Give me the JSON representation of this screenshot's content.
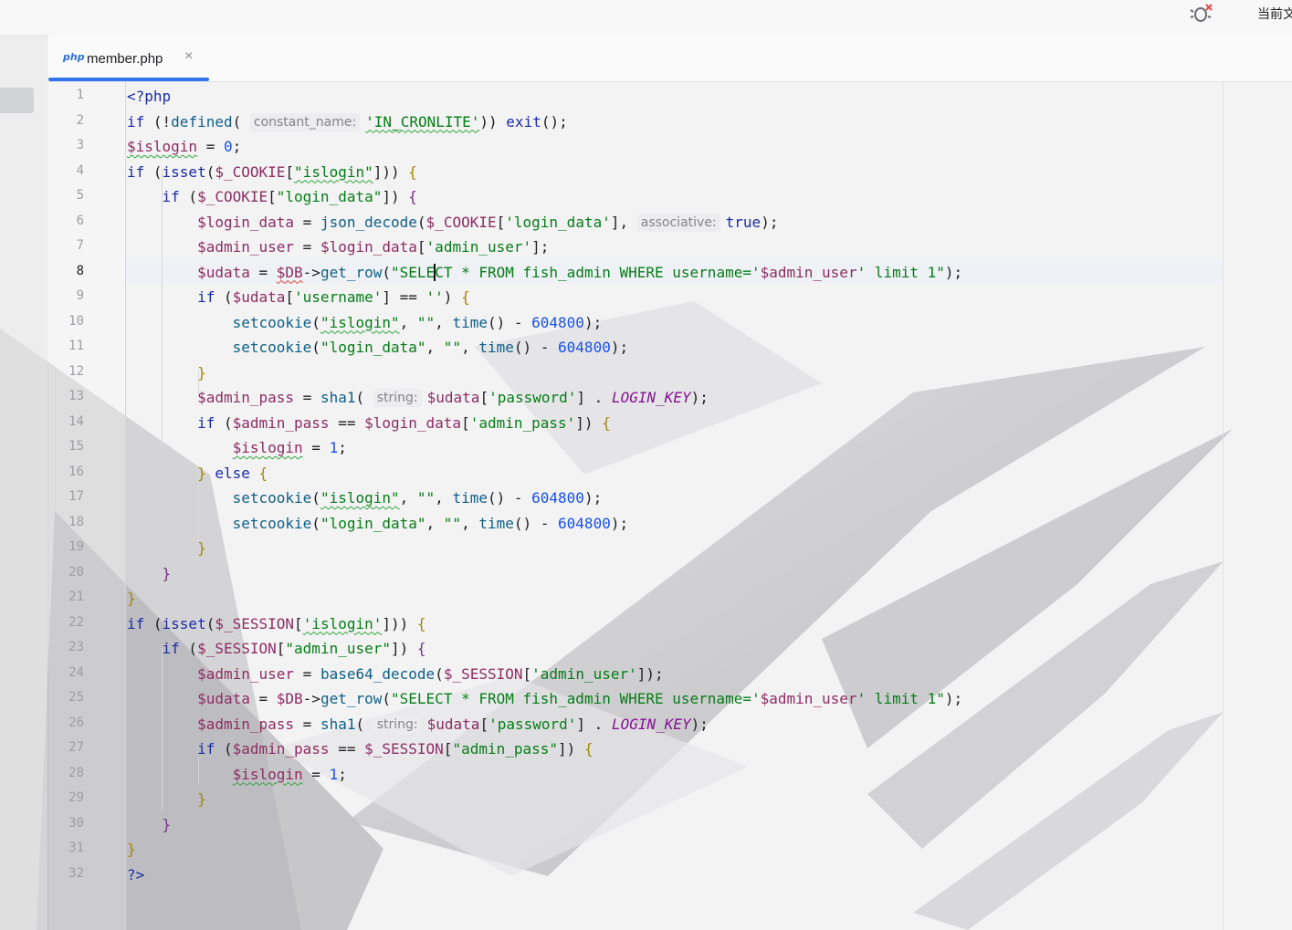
{
  "topbar": {
    "right_label": "当前文",
    "icon": "bug-icon"
  },
  "tab": {
    "icon_text": "php",
    "label": "member.php",
    "close": "×"
  },
  "editor": {
    "active_line": 8,
    "line_numbers": [
      "1",
      "2",
      "3",
      "4",
      "5",
      "6",
      "7",
      "8",
      "9",
      "10",
      "11",
      "12",
      "13",
      "14",
      "15",
      "16",
      "17",
      "18",
      "19",
      "20",
      "21",
      "22",
      "23",
      "24",
      "25",
      "26",
      "27",
      "28",
      "29",
      "30",
      "31",
      "32"
    ],
    "lines": [
      [
        {
          "t": "<?php",
          "c": "tag"
        }
      ],
      [
        {
          "t": "if",
          "c": "kw"
        },
        {
          "t": " ("
        },
        {
          "t": "!"
        },
        {
          "t": "defined",
          "c": "fn"
        },
        {
          "t": "( "
        },
        {
          "t": "constant_name:",
          "c": "hint"
        },
        {
          "t": "'IN_CRONLITE'",
          "c": "str squig"
        },
        {
          "t": ")) "
        },
        {
          "t": "exit",
          "c": "kw"
        },
        {
          "t": "();"
        }
      ],
      [
        {
          "t": "$islogin",
          "c": "var squig"
        },
        {
          "t": " = "
        },
        {
          "t": "0",
          "c": "num"
        },
        {
          "t": ";"
        }
      ],
      [
        {
          "t": "if",
          "c": "kw"
        },
        {
          "t": " ("
        },
        {
          "t": "isset",
          "c": "kw"
        },
        {
          "t": "("
        },
        {
          "t": "$_COOKIE",
          "c": "var"
        },
        {
          "t": "["
        },
        {
          "t": "\"islogin\"",
          "c": "str squig"
        },
        {
          "t": "])) "
        },
        {
          "t": "{",
          "c": "br1"
        }
      ],
      [
        {
          "t": "    "
        },
        {
          "t": "if",
          "c": "kw"
        },
        {
          "t": " ("
        },
        {
          "t": "$_COOKIE",
          "c": "var"
        },
        {
          "t": "["
        },
        {
          "t": "\"login_data\"",
          "c": "str"
        },
        {
          "t": "]) "
        },
        {
          "t": "{",
          "c": "br2"
        }
      ],
      [
        {
          "t": "        "
        },
        {
          "t": "$login_data",
          "c": "var"
        },
        {
          "t": " = "
        },
        {
          "t": "json_decode",
          "c": "fn"
        },
        {
          "t": "("
        },
        {
          "t": "$_COOKIE",
          "c": "var"
        },
        {
          "t": "["
        },
        {
          "t": "'login_data'",
          "c": "str"
        },
        {
          "t": "], "
        },
        {
          "t": "associative:",
          "c": "hint"
        },
        {
          "t": "true",
          "c": "kw"
        },
        {
          "t": ");"
        }
      ],
      [
        {
          "t": "        "
        },
        {
          "t": "$admin_user",
          "c": "var"
        },
        {
          "t": " = "
        },
        {
          "t": "$login_data",
          "c": "var"
        },
        {
          "t": "["
        },
        {
          "t": "'admin_user'",
          "c": "str"
        },
        {
          "t": "];"
        }
      ],
      [
        {
          "t": "        "
        },
        {
          "t": "$udata",
          "c": "var"
        },
        {
          "t": " = "
        },
        {
          "t": "$DB",
          "c": "var squig-red"
        },
        {
          "t": "->"
        },
        {
          "t": "get_row",
          "c": "fn"
        },
        {
          "t": "("
        },
        {
          "t": "\"SELE",
          "c": "str"
        },
        {
          "t": "",
          "c": "caret"
        },
        {
          "t": "CT * FROM fish_admin WHERE username='",
          "c": "str"
        },
        {
          "t": "$admin_user",
          "c": "var"
        },
        {
          "t": "' limit 1\"",
          "c": "str"
        },
        {
          "t": ");"
        }
      ],
      [
        {
          "t": "        "
        },
        {
          "t": "if",
          "c": "kw"
        },
        {
          "t": " ("
        },
        {
          "t": "$udata",
          "c": "var"
        },
        {
          "t": "["
        },
        {
          "t": "'username'",
          "c": "str"
        },
        {
          "t": "] == "
        },
        {
          "t": "''",
          "c": "str"
        },
        {
          "t": ") "
        },
        {
          "t": "{",
          "c": "br1"
        }
      ],
      [
        {
          "t": "            "
        },
        {
          "t": "setcookie",
          "c": "fn"
        },
        {
          "t": "("
        },
        {
          "t": "\"islogin\"",
          "c": "str squig"
        },
        {
          "t": ", "
        },
        {
          "t": "\"\"",
          "c": "str"
        },
        {
          "t": ", "
        },
        {
          "t": "time",
          "c": "fn"
        },
        {
          "t": "() - "
        },
        {
          "t": "604800",
          "c": "num"
        },
        {
          "t": ");"
        }
      ],
      [
        {
          "t": "            "
        },
        {
          "t": "setcookie",
          "c": "fn"
        },
        {
          "t": "("
        },
        {
          "t": "\"login_data\"",
          "c": "str"
        },
        {
          "t": ", "
        },
        {
          "t": "\"\"",
          "c": "str"
        },
        {
          "t": ", "
        },
        {
          "t": "time",
          "c": "fn"
        },
        {
          "t": "() - "
        },
        {
          "t": "604800",
          "c": "num"
        },
        {
          "t": ");"
        }
      ],
      [
        {
          "t": "        "
        },
        {
          "t": "}",
          "c": "br1"
        }
      ],
      [
        {
          "t": "        "
        },
        {
          "t": "$admin_pass",
          "c": "var"
        },
        {
          "t": " = "
        },
        {
          "t": "sha1",
          "c": "fn"
        },
        {
          "t": "( "
        },
        {
          "t": "string:",
          "c": "hint"
        },
        {
          "t": "$udata",
          "c": "var"
        },
        {
          "t": "["
        },
        {
          "t": "'password'",
          "c": "str"
        },
        {
          "t": "] . "
        },
        {
          "t": "LOGIN_KEY",
          "c": "const"
        },
        {
          "t": ");"
        }
      ],
      [
        {
          "t": "        "
        },
        {
          "t": "if",
          "c": "kw"
        },
        {
          "t": " ("
        },
        {
          "t": "$admin_pass",
          "c": "var"
        },
        {
          "t": " == "
        },
        {
          "t": "$login_data",
          "c": "var"
        },
        {
          "t": "["
        },
        {
          "t": "'admin_pass'",
          "c": "str"
        },
        {
          "t": "]) "
        },
        {
          "t": "{",
          "c": "br1"
        }
      ],
      [
        {
          "t": "            "
        },
        {
          "t": "$islogin",
          "c": "var squig"
        },
        {
          "t": " = "
        },
        {
          "t": "1",
          "c": "num"
        },
        {
          "t": ";"
        }
      ],
      [
        {
          "t": "        "
        },
        {
          "t": "}",
          "c": "br1"
        },
        {
          "t": " "
        },
        {
          "t": "else",
          "c": "kw"
        },
        {
          "t": " "
        },
        {
          "t": "{",
          "c": "br1"
        }
      ],
      [
        {
          "t": "            "
        },
        {
          "t": "setcookie",
          "c": "fn"
        },
        {
          "t": "("
        },
        {
          "t": "\"islogin\"",
          "c": "str squig"
        },
        {
          "t": ", "
        },
        {
          "t": "\"\"",
          "c": "str"
        },
        {
          "t": ", "
        },
        {
          "t": "time",
          "c": "fn"
        },
        {
          "t": "() - "
        },
        {
          "t": "604800",
          "c": "num"
        },
        {
          "t": ");"
        }
      ],
      [
        {
          "t": "            "
        },
        {
          "t": "setcookie",
          "c": "fn"
        },
        {
          "t": "("
        },
        {
          "t": "\"login_data\"",
          "c": "str"
        },
        {
          "t": ", "
        },
        {
          "t": "\"\"",
          "c": "str"
        },
        {
          "t": ", "
        },
        {
          "t": "time",
          "c": "fn"
        },
        {
          "t": "() - "
        },
        {
          "t": "604800",
          "c": "num"
        },
        {
          "t": ");"
        }
      ],
      [
        {
          "t": "        "
        },
        {
          "t": "}",
          "c": "br1"
        }
      ],
      [
        {
          "t": "    "
        },
        {
          "t": "}",
          "c": "br2"
        }
      ],
      [
        {
          "t": "}",
          "c": "br1"
        }
      ],
      [
        {
          "t": "if",
          "c": "kw"
        },
        {
          "t": " ("
        },
        {
          "t": "isset",
          "c": "kw"
        },
        {
          "t": "("
        },
        {
          "t": "$_SESSION",
          "c": "var"
        },
        {
          "t": "["
        },
        {
          "t": "'islogin'",
          "c": "str squig"
        },
        {
          "t": "])) "
        },
        {
          "t": "{",
          "c": "br1"
        }
      ],
      [
        {
          "t": "    "
        },
        {
          "t": "if",
          "c": "kw"
        },
        {
          "t": " ("
        },
        {
          "t": "$_SESSION",
          "c": "var"
        },
        {
          "t": "["
        },
        {
          "t": "\"admin_user\"",
          "c": "str"
        },
        {
          "t": "]) "
        },
        {
          "t": "{",
          "c": "br2"
        }
      ],
      [
        {
          "t": "        "
        },
        {
          "t": "$admin_user",
          "c": "var"
        },
        {
          "t": " = "
        },
        {
          "t": "base64_decode",
          "c": "fn"
        },
        {
          "t": "("
        },
        {
          "t": "$_SESSION",
          "c": "var"
        },
        {
          "t": "["
        },
        {
          "t": "'admin_user'",
          "c": "str"
        },
        {
          "t": "]);"
        }
      ],
      [
        {
          "t": "        "
        },
        {
          "t": "$udata",
          "c": "var"
        },
        {
          "t": " = "
        },
        {
          "t": "$DB",
          "c": "var"
        },
        {
          "t": "->"
        },
        {
          "t": "get_row",
          "c": "fn"
        },
        {
          "t": "("
        },
        {
          "t": "\"SELECT * FROM fish_admin WHERE username='",
          "c": "str"
        },
        {
          "t": "$admin_user",
          "c": "var"
        },
        {
          "t": "' limit 1\"",
          "c": "str"
        },
        {
          "t": ");"
        }
      ],
      [
        {
          "t": "        "
        },
        {
          "t": "$admin_pass",
          "c": "var"
        },
        {
          "t": " = "
        },
        {
          "t": "sha1",
          "c": "fn"
        },
        {
          "t": "( "
        },
        {
          "t": "string:",
          "c": "hint"
        },
        {
          "t": "$udata",
          "c": "var"
        },
        {
          "t": "["
        },
        {
          "t": "'password'",
          "c": "str"
        },
        {
          "t": "] . "
        },
        {
          "t": "LOGIN_KEY",
          "c": "const"
        },
        {
          "t": ");"
        }
      ],
      [
        {
          "t": "        "
        },
        {
          "t": "if",
          "c": "kw"
        },
        {
          "t": " ("
        },
        {
          "t": "$admin_pass",
          "c": "var"
        },
        {
          "t": " == "
        },
        {
          "t": "$_SESSION",
          "c": "var"
        },
        {
          "t": "["
        },
        {
          "t": "\"admin_pass\"",
          "c": "str"
        },
        {
          "t": "]) "
        },
        {
          "t": "{",
          "c": "br1"
        }
      ],
      [
        {
          "t": "            "
        },
        {
          "t": "$islogin",
          "c": "var squig"
        },
        {
          "t": " = "
        },
        {
          "t": "1",
          "c": "num"
        },
        {
          "t": ";"
        }
      ],
      [
        {
          "t": "        "
        },
        {
          "t": "}",
          "c": "br1"
        }
      ],
      [
        {
          "t": "    "
        },
        {
          "t": "}",
          "c": "br2"
        }
      ],
      [
        {
          "t": "}",
          "c": "br1"
        }
      ],
      [
        {
          "t": "?>",
          "c": "tag"
        }
      ]
    ]
  }
}
